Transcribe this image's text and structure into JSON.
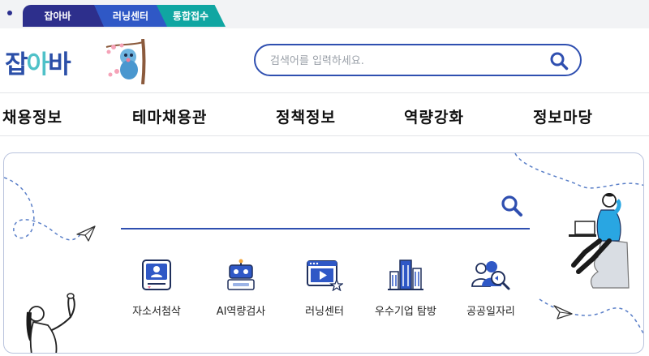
{
  "top_tabs": [
    "잡아바",
    "러닝센터",
    "통합접수"
  ],
  "logo": {
    "part1": "잡",
    "part2": "아",
    "part3": "바"
  },
  "search": {
    "placeholder": "검색어를 입력하세요."
  },
  "nav": [
    "채용정보",
    "테마채용관",
    "정책정보",
    "역량강화",
    "정보마당"
  ],
  "hero_search": {
    "placeholder": ""
  },
  "quick_links": [
    {
      "label": "자소서첨삭",
      "icon": "resume-icon"
    },
    {
      "label": "AI역량검사",
      "icon": "robot-icon"
    },
    {
      "label": "러닝센터",
      "icon": "video-play-icon"
    },
    {
      "label": "우수기업 탐방",
      "icon": "buildings-icon"
    },
    {
      "label": "공공일자리",
      "icon": "people-search-icon"
    }
  ],
  "colors": {
    "navy": "#2d2f8c",
    "blue": "#2f58c6",
    "teal": "#10a6a2",
    "accent": "#2f4fb0"
  }
}
